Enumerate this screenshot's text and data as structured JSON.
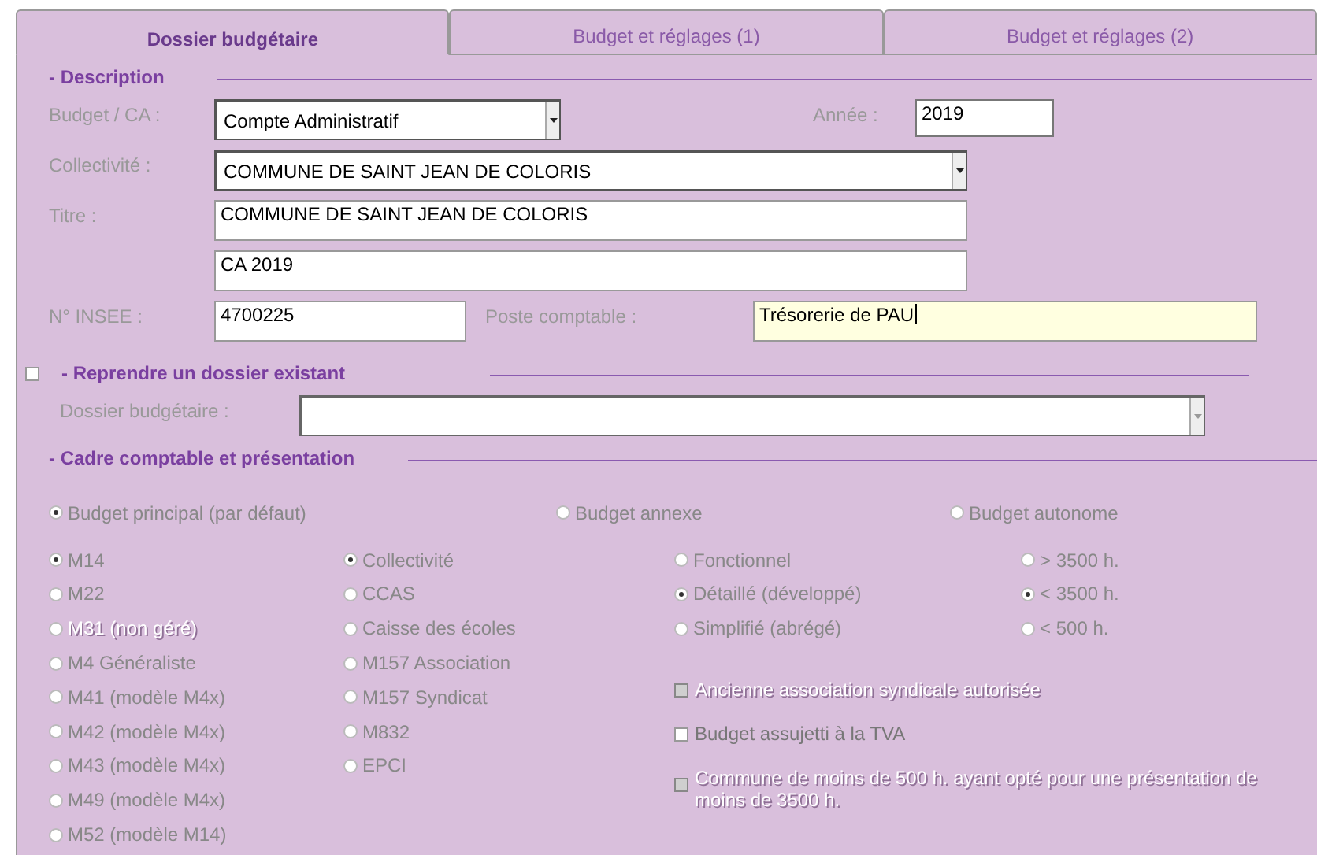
{
  "tabs": [
    {
      "label": "Dossier budgétaire",
      "selected": true
    },
    {
      "label": "Budget et réglages (1)",
      "selected": false
    },
    {
      "label": "Budget et réglages (2)",
      "selected": false
    }
  ],
  "description": {
    "title": "- Description",
    "budget_ca": {
      "label": "Budget / CA :",
      "value": "Compte Administratif"
    },
    "annee": {
      "label": "Année :",
      "value": "2019"
    },
    "collectivite": {
      "label": "Collectivité :",
      "value": "COMMUNE DE SAINT JEAN DE COLORIS"
    },
    "titre": {
      "label": "Titre :",
      "lines": [
        "COMMUNE DE SAINT JEAN DE COLORIS",
        "CA 2019"
      ]
    },
    "insee": {
      "label": "N° INSEE :",
      "value": "4700225"
    },
    "poste": {
      "label": "Poste comptable :",
      "value": "Trésorerie de PAU",
      "focused": true
    }
  },
  "reprendre": {
    "title": "- Reprendre un dossier existant",
    "checked": false,
    "field_label": "Dossier budgétaire :"
  },
  "cadre": {
    "title": "- Cadre comptable et présentation",
    "budget_types": [
      {
        "label": "Budget principal (par défaut)",
        "selected": true
      },
      {
        "label": "Budget annexe",
        "selected": false
      },
      {
        "label": "Budget autonome",
        "selected": false
      }
    ],
    "nomenclatures": [
      {
        "label": "M14",
        "selected": true,
        "disabled": false
      },
      {
        "label": "M22",
        "selected": false,
        "disabled": false
      },
      {
        "label": "M31 (non géré)",
        "selected": false,
        "disabled": true
      },
      {
        "label": "M4 Généraliste",
        "selected": false,
        "disabled": false
      },
      {
        "label": "M41 (modèle M4x)",
        "selected": false,
        "disabled": false
      },
      {
        "label": "M42 (modèle M4x)",
        "selected": false,
        "disabled": false
      },
      {
        "label": "M43 (modèle M4x)",
        "selected": false,
        "disabled": false
      },
      {
        "label": "M49 (modèle M4x)",
        "selected": false,
        "disabled": false
      },
      {
        "label": "M52 (modèle M14)",
        "selected": false,
        "disabled": false
      }
    ],
    "organismes": [
      {
        "label": "Collectivité",
        "selected": true
      },
      {
        "label": "CCAS",
        "selected": false
      },
      {
        "label": "Caisse des écoles",
        "selected": false
      },
      {
        "label": "M157 Association",
        "selected": false
      },
      {
        "label": "M157 Syndicat",
        "selected": false
      },
      {
        "label": "M832",
        "selected": false
      },
      {
        "label": "EPCI",
        "selected": false
      }
    ],
    "presentations": [
      {
        "label": "Fonctionnel",
        "selected": false
      },
      {
        "label": "Détaillé (développé)",
        "selected": true
      },
      {
        "label": "Simplifié (abrégé)",
        "selected": false
      }
    ],
    "populations": [
      {
        "label": "> 3500 h.",
        "selected": false
      },
      {
        "label": "< 3500 h.",
        "selected": true
      },
      {
        "label": "< 500 h.",
        "selected": false
      }
    ],
    "options": [
      {
        "label": "Ancienne association syndicale autorisée",
        "checked": false,
        "disabled": true
      },
      {
        "label": "Budget assujetti à la TVA",
        "checked": false,
        "disabled": false
      },
      {
        "label": "Commune de moins de 500 h. ayant opté pour une présentation de moins de 3500 h.",
        "checked": false,
        "disabled": true
      }
    ]
  }
}
